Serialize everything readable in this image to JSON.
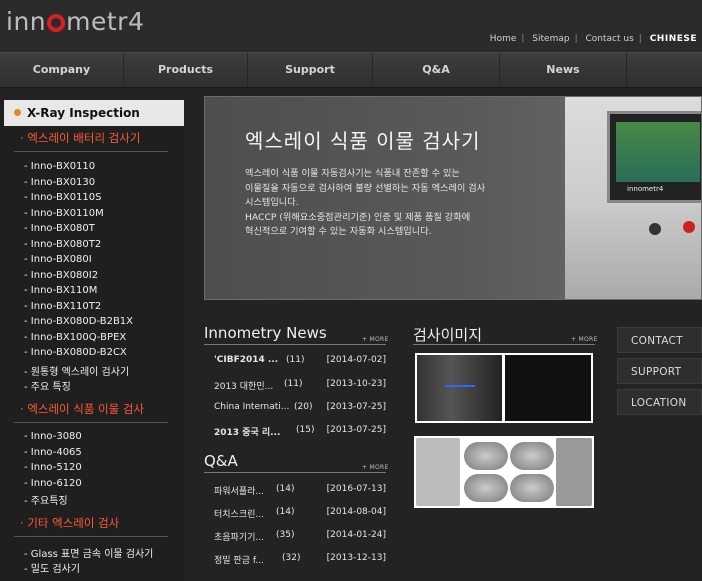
{
  "header": {
    "logo_text": "innometr4",
    "util_links": [
      "Home",
      "Sitemap",
      "Contact us",
      "CHINESE"
    ]
  },
  "nav": {
    "items": [
      "Company",
      "Products",
      "Support",
      "Q&A",
      "News"
    ]
  },
  "sidebar": {
    "title": "X-Ray  Inspection",
    "categories": [
      {
        "label": "엑스레이 배터리 검사기",
        "items": [
          "Inno-BX0110",
          "Inno-BX0130",
          "Inno-BX0110S",
          "Inno-BX0110M",
          "Inno-BX080T",
          "Inno-BX080T2",
          "Inno-BX080I",
          "Inno-BX080I2",
          "Inno-BX110M",
          "Inno-BX110T2",
          "Inno-BX080D-B2B1X",
          "Inno-BX100Q-BPEX",
          "Inno-BX080D-B2CX",
          "원통형 엑스레이 검사기",
          "주요 특징"
        ]
      },
      {
        "label": "엑스레이 식품 이물 검사",
        "items": [
          "Inno-3080",
          "Inno-4065",
          "Inno-5120",
          "Inno-6120",
          "주요특징"
        ]
      },
      {
        "label": "기타 엑스레이 검사",
        "items": [
          "Glass 표면 금속 이물 검사기",
          "밀도 검사기"
        ]
      }
    ]
  },
  "banner": {
    "title": "엑스레이 식품 이물 검사기",
    "desc_lines": [
      "엑스레이 식품 이물 자동검사기는 식품내 잔존할 수 있는",
      "이물질을 자동으로 검사하여 불량 선별하는 자동 엑스레이 검사",
      "시스템입니다.",
      "HACCP (위해요소중점관리기준) 인증 및 제품 품질 강화에",
      "혁신적으로 기여할 수 있는 자동화 시스템입니다."
    ],
    "machine_brand": "innometr4"
  },
  "news": {
    "title": "Innometry News",
    "more": "+ MORE",
    "rows": [
      {
        "title": "'CIBF2014 ...",
        "count": "(11)",
        "date": "[2014-07-02]",
        "bold": true
      },
      {
        "title": "2013 대한민...",
        "count": "(11)",
        "date": "[2013-10-23]",
        "bold": false
      },
      {
        "title": "China Internati...",
        "count": "(20)",
        "date": "[2013-07-25]",
        "bold": false
      },
      {
        "title": "2013 중국 리...",
        "count": "(15)",
        "date": "[2013-07-25]",
        "bold": true
      }
    ]
  },
  "qa": {
    "title": "Q&A",
    "more": "+ MORE",
    "rows": [
      {
        "title": "파워서플라...",
        "count": "(14)",
        "date": "[2016-07-13]",
        "bold": false
      },
      {
        "title": "터치스크린...",
        "count": "(14)",
        "date": "[2014-08-04]",
        "bold": false
      },
      {
        "title": "초음파기기...",
        "count": "(35)",
        "date": "[2014-01-24]",
        "bold": false
      },
      {
        "title": "정밀 판금 f...",
        "count": "(32)",
        "date": "[2013-12-13]",
        "bold": false
      }
    ]
  },
  "images": {
    "title": "검사이미지",
    "more": "+ MORE"
  },
  "quick_links": [
    "CONTACT US",
    "SUPPORT",
    "LOCATION"
  ]
}
